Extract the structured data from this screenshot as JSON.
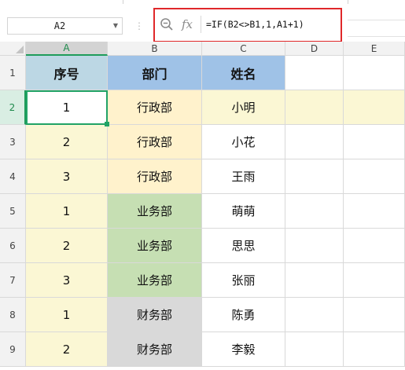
{
  "namebox": {
    "value": "A2"
  },
  "formula_bar": {
    "fx_label": "fx",
    "formula": "=IF(B2<>B1,1,A1+1)"
  },
  "columns": [
    "A",
    "B",
    "C",
    "D",
    "E"
  ],
  "rows": [
    "1",
    "2",
    "3",
    "4",
    "5",
    "6",
    "7",
    "8",
    "9"
  ],
  "active_cell": "A2",
  "colors": {
    "header_blue": "#9fc2e7",
    "header_a": "#bcd7e4",
    "col_a": "#fbf7d4",
    "row2_highlight": "#fbf7d4",
    "admin": "#fff2cc",
    "business": "#c6dfb3",
    "finance": "#d9d9d9",
    "selection": "#21a366",
    "formula_frame": "#e0282a"
  },
  "table": {
    "headers": [
      "序号",
      "部门",
      "姓名"
    ],
    "rows": [
      [
        "1",
        "行政部",
        "小明"
      ],
      [
        "2",
        "行政部",
        "小花"
      ],
      [
        "3",
        "行政部",
        "王雨"
      ],
      [
        "1",
        "业务部",
        "萌萌"
      ],
      [
        "2",
        "业务部",
        "思思"
      ],
      [
        "3",
        "业务部",
        "张丽"
      ],
      [
        "1",
        "财务部",
        "陈勇"
      ],
      [
        "2",
        "财务部",
        "李毅"
      ]
    ]
  }
}
